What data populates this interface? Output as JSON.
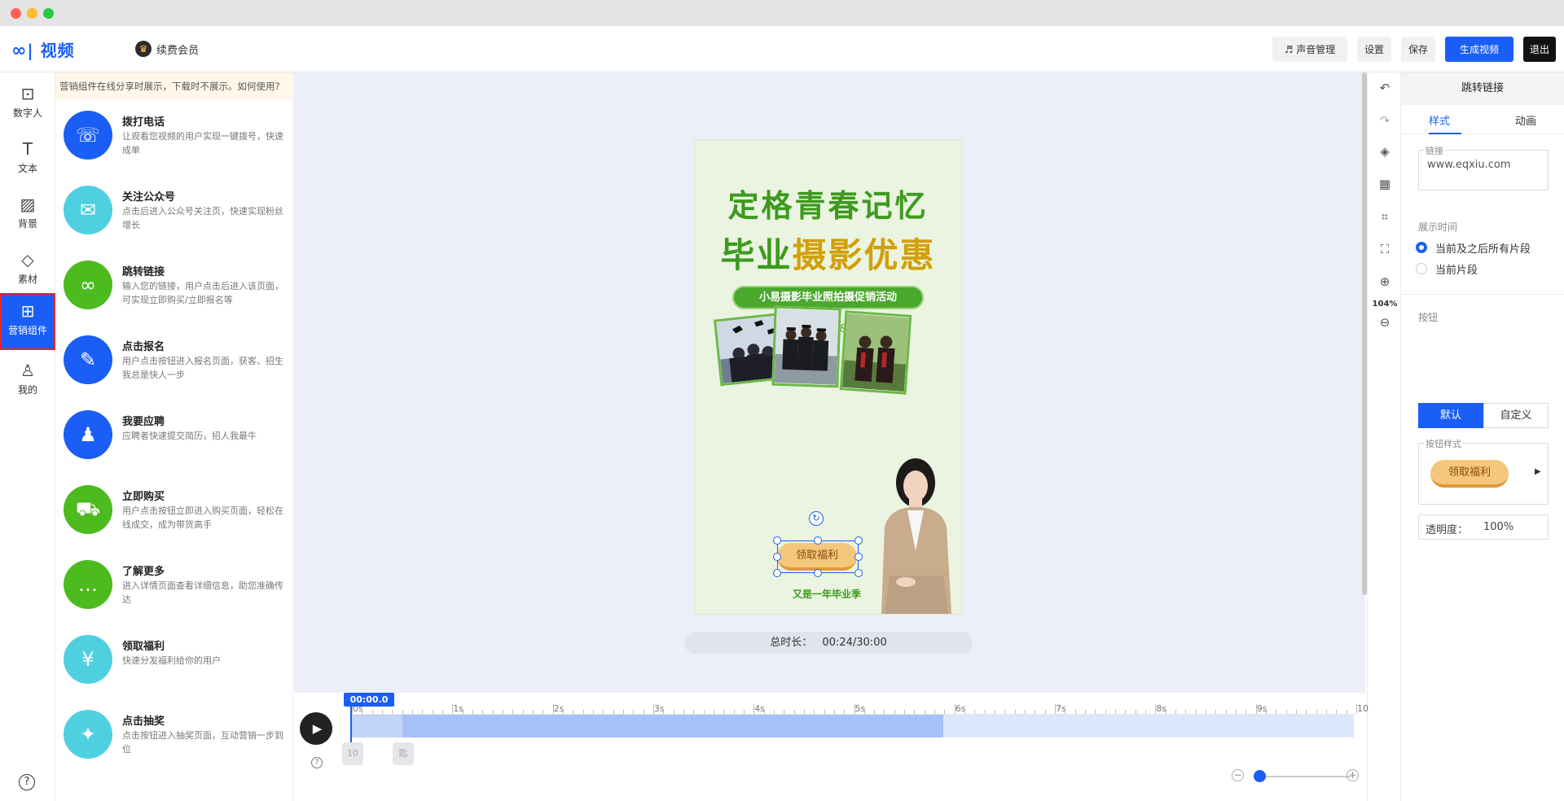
{
  "app": {
    "logo_mark": "∞",
    "logo_text": "| 视频",
    "vip_label": "续费会员"
  },
  "toolbar": {
    "sound_label": "♬ 声音管理",
    "settings_label": "设置",
    "save_label": "保存",
    "generate_label": "生成视频",
    "exit_label": "退出"
  },
  "leftnav": {
    "items": [
      {
        "label": "数字人",
        "icon": "person-box-icon"
      },
      {
        "label": "文本",
        "icon": "text-icon"
      },
      {
        "label": "背景",
        "icon": "background-icon"
      },
      {
        "label": "素材",
        "icon": "shapes-icon"
      },
      {
        "label": "营销组件",
        "icon": "grid-icon"
      },
      {
        "label": "我的",
        "icon": "user-icon"
      }
    ]
  },
  "panel": {
    "notice": "营销组件在线分享时展示，下载时不展示。如何使用?",
    "components": [
      {
        "name": "拨打电话",
        "desc": "让观看您视频的用户实现一键拨号，快速成单",
        "color": "#1a5ef5",
        "icon": "☏"
      },
      {
        "name": "关注公众号",
        "desc": "点击后进入公众号关注页，快速实现粉丝增长",
        "color": "#4fd0e0",
        "icon": "✉"
      },
      {
        "name": "跳转链接",
        "desc": "输入您的链接，用户点击后进入该页面，可实现立即购买/立即报名等",
        "color": "#4cbb1e",
        "icon": "∞"
      },
      {
        "name": "点击报名",
        "desc": "用户点击按钮进入报名页面，获客、招生我总是快人一步",
        "color": "#1a5ef5",
        "icon": "✎"
      },
      {
        "name": "我要应聘",
        "desc": "应聘者快速提交简历，招人我最牛",
        "color": "#1a5ef5",
        "icon": "♟"
      },
      {
        "name": "立即购买",
        "desc": "用户点击按钮立即进入购买页面，轻松在线成交，成为带货高手",
        "color": "#4cbb1e",
        "icon": "⛟"
      },
      {
        "name": "了解更多",
        "desc": "进入详情页面查看详细信息，助您准确传达",
        "color": "#4cbb1e",
        "icon": "…"
      },
      {
        "name": "领取福利",
        "desc": "快速分发福利给你的用户",
        "color": "#4fd0e0",
        "icon": "¥"
      },
      {
        "name": "点击抽奖",
        "desc": "点击按钮进入抽奖页面，互动营销一步到位",
        "color": "#4fd0e0",
        "icon": "✦"
      }
    ]
  },
  "poster": {
    "title1": "定格青春记忆",
    "title2_green": "毕业",
    "title2_yellow": "摄影优惠",
    "pill": "小易摄影毕业照拍摄促销活动",
    "subtitle": "—感恩&成长&欢笑—",
    "cta": "领取福利",
    "footer": "又是一年毕业季"
  },
  "duration": {
    "label": "总时长：",
    "value": "00:24/30:00"
  },
  "right_tools": {
    "zoom": "104%"
  },
  "props": {
    "title": "跳转链接",
    "tabs": [
      "样式",
      "动画"
    ],
    "link_legend": "链接",
    "link_value": "www.eqxiu.com",
    "display_time_label": "展示时间",
    "display_options": [
      "当前及之后所有片段",
      "当前片段"
    ],
    "button_label": "按钮",
    "button_modes": [
      "默认",
      "自定义"
    ],
    "button_style_legend": "按钮样式",
    "button_preview": "领取福利",
    "opacity_label": "透明度：",
    "opacity_value": "100%"
  },
  "timeline": {
    "playhead": "00:00.0",
    "ticks": [
      "0s",
      "1s",
      "2s",
      "3s",
      "4s",
      "5s",
      "6s",
      "7s",
      "8s",
      "9s",
      "10"
    ],
    "chips": [
      "10",
      "匙"
    ]
  }
}
